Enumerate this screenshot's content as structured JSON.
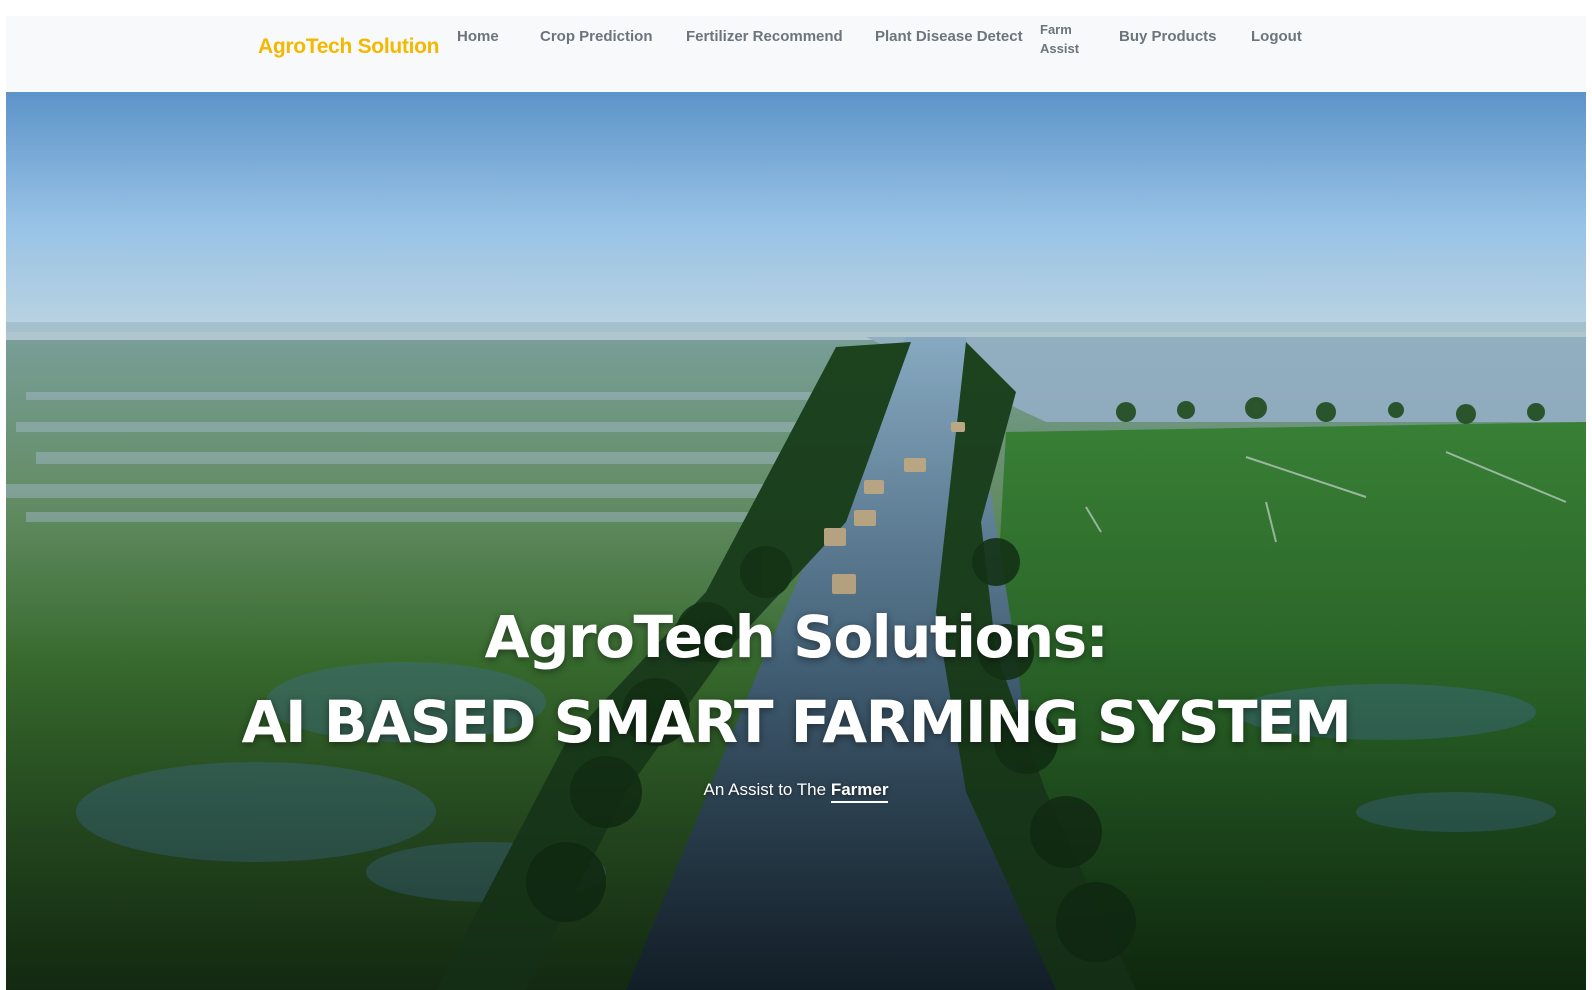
{
  "navbar": {
    "brand": "AgroTech Solution",
    "links": [
      {
        "label": "Home"
      },
      {
        "label": "Crop Prediction"
      },
      {
        "label": "Fertilizer Recommend"
      },
      {
        "label": "Plant Disease Detect"
      },
      {
        "label": "Farm Assist"
      },
      {
        "label": "Buy Products"
      },
      {
        "label": "Logout"
      }
    ]
  },
  "hero": {
    "title": "AgroTech Solutions:",
    "subtitle": "AI BASED SMART FARMING SYSTEM",
    "tagline_prefix": "An Assist to The",
    "tagline_emphasis": "Farmer"
  },
  "colors": {
    "brand": "#f5b800",
    "nav_bg": "#f8f9fa",
    "nav_link": "#6c757d"
  }
}
